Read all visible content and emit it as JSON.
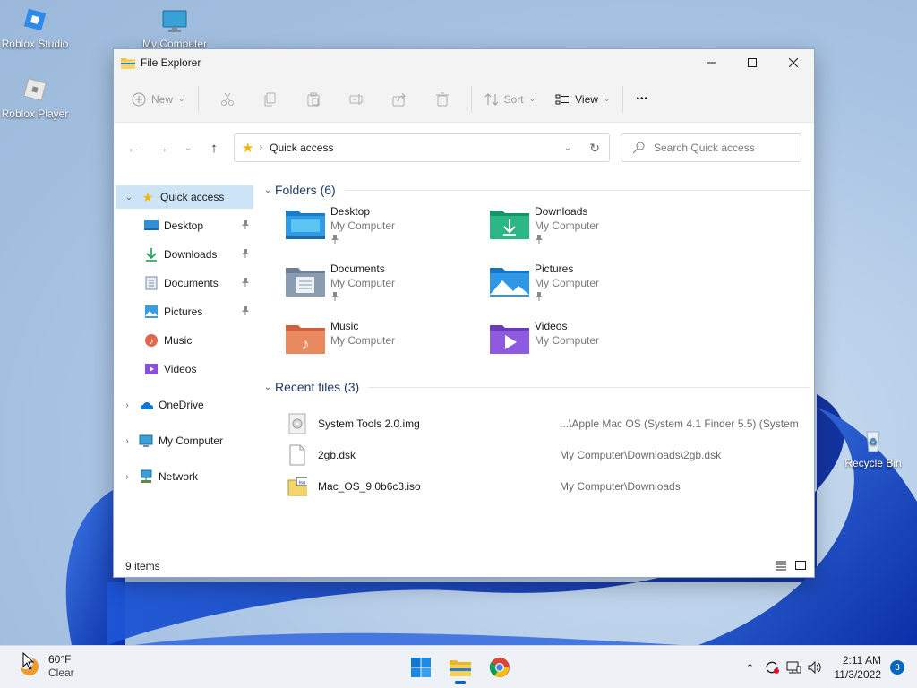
{
  "desktop": {
    "icons": [
      {
        "label": "Roblox Studio"
      },
      {
        "label": "Roblox Player"
      },
      {
        "label": "My Computer"
      },
      {
        "label": "Recycle Bin"
      }
    ]
  },
  "window": {
    "title": "File Explorer",
    "commandbar": {
      "new_label": "New",
      "sort_label": "Sort",
      "view_label": "View",
      "more_label": "•••"
    },
    "address": {
      "breadcrumb": "Quick access",
      "search_placeholder": "Search Quick access"
    },
    "navpane": {
      "quick_access": "Quick access",
      "pinned": [
        {
          "label": "Desktop",
          "pinned": true
        },
        {
          "label": "Downloads",
          "pinned": true
        },
        {
          "label": "Documents",
          "pinned": true
        },
        {
          "label": "Pictures",
          "pinned": true
        },
        {
          "label": "Music",
          "pinned": false
        },
        {
          "label": "Videos",
          "pinned": false
        }
      ],
      "onedrive": "OneDrive",
      "my_computer": "My Computer",
      "network": "Network"
    },
    "folders_header": "Folders (6)",
    "folders": [
      {
        "name": "Desktop",
        "location": "My Computer",
        "pinned": true
      },
      {
        "name": "Downloads",
        "location": "My Computer",
        "pinned": true
      },
      {
        "name": "Documents",
        "location": "My Computer",
        "pinned": true
      },
      {
        "name": "Pictures",
        "location": "My Computer",
        "pinned": true
      },
      {
        "name": "Music",
        "location": "My Computer",
        "pinned": false
      },
      {
        "name": "Videos",
        "location": "My Computer",
        "pinned": false
      }
    ],
    "recent_header": "Recent files (3)",
    "recent_files": [
      {
        "name": "System Tools 2.0.img",
        "path": "...\\Apple Mac OS (System 4.1 Finder 5.5) (System ..."
      },
      {
        "name": "2gb.dsk",
        "path": "My Computer\\Downloads\\2gb.dsk"
      },
      {
        "name": "Mac_OS_9.0b6c3.iso",
        "path": "My Computer\\Downloads"
      }
    ],
    "status": "9 items"
  },
  "taskbar": {
    "weather_temp": "60°F",
    "weather_cond": "Clear",
    "time": "2:11 AM",
    "date": "11/3/2022",
    "notifications": "3"
  },
  "colors": {
    "accent": "#0067c0",
    "selection": "#cde4f7",
    "section_header": "#1f3b66"
  }
}
